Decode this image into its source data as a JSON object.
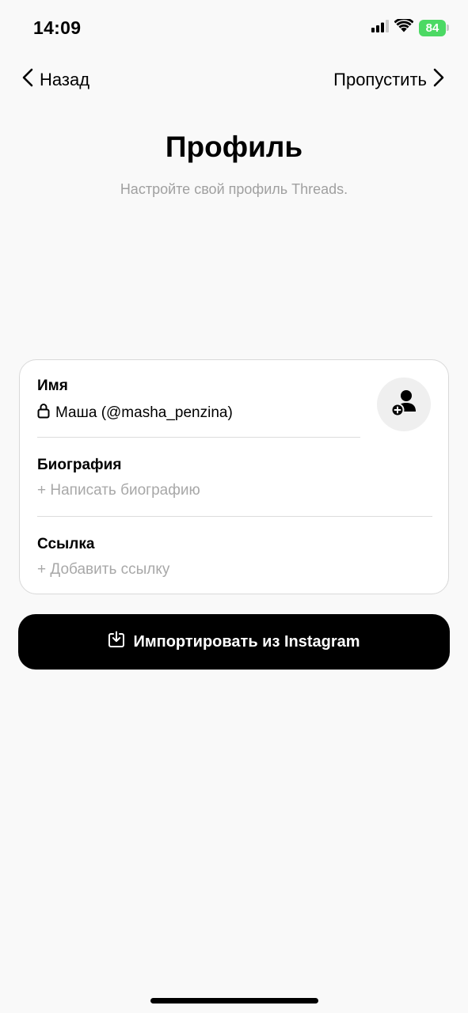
{
  "status_bar": {
    "time": "14:09",
    "battery_level": "84",
    "signal_icon": "cellular-signal-icon",
    "wifi_icon": "wifi-icon",
    "battery_color": "#4cd964"
  },
  "nav": {
    "back_label": "Назад",
    "back_icon": "chevron-left-icon",
    "skip_label": "Пропустить",
    "skip_icon": "chevron-right-icon"
  },
  "header": {
    "title": "Профиль",
    "subtitle": "Настройте свой профиль Threads."
  },
  "profile_card": {
    "name": {
      "label": "Имя",
      "value": "Маша (@masha_penzina)",
      "lock_icon": "lock-icon"
    },
    "bio": {
      "label": "Биография",
      "placeholder": "+ Написать биографию"
    },
    "link": {
      "label": "Ссылка",
      "placeholder": "+ Добавить ссылку"
    },
    "avatar_icon": "add-profile-photo-icon"
  },
  "import_button": {
    "label": "Импортировать из Instagram",
    "icon": "import-icon"
  },
  "colors": {
    "background": "#f9f9f9",
    "button": "#000000",
    "placeholder": "#a8a8a8",
    "subtitle": "#a0a0a0"
  }
}
